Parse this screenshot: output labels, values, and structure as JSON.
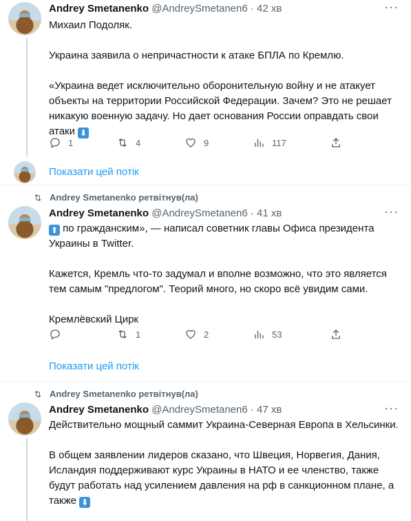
{
  "tweets": [
    {
      "retweeted_by": "",
      "name": "Andrey Smetanenko",
      "handle": "@AndreySmetanen6",
      "time": "42 хв",
      "paragraphs": [
        "Михаил Подоляк.",
        "Украина заявила о непричастности к атаке БПЛА по Кремлю.",
        "«Украина ведет исключительно оборонительную войну и не атакует объекты на территории Российской Федерации. Зачем? Это не решает никакую военную задачу. Но дает основания России оправдать свои атаки"
      ],
      "stats": {
        "replies": "1",
        "retweets": "4",
        "likes": "9",
        "views": "117"
      },
      "show_thread": "Показати цей потік"
    },
    {
      "retweeted_by": "Andrey Smetanenko ретвітнув(ла)",
      "name": "Andrey Smetanenko",
      "handle": "@AndreySmetanen6",
      "time": "41 хв",
      "paragraphs": [
        " по гражданским», — написал советник главы Офиса президента Украины в Twitter.",
        "Кажется, Кремль что-то задумал и вполне возможно, что это является тем самым \"предлогом\". Теорий много, но скоро всё увидим сами.",
        "Кремлёвский Цирк"
      ],
      "stats": {
        "replies": "",
        "retweets": "1",
        "likes": "2",
        "views": "53"
      },
      "show_thread": "Показати цей потік"
    },
    {
      "retweeted_by": "Andrey Smetanenko ретвітнув(ла)",
      "name": "Andrey Smetanenko",
      "handle": "@AndreySmetanen6",
      "time": "47 хв",
      "paragraphs": [
        "Действительно мощный саммит Украина-Северная Европа в Хельсинки.",
        "В общем заявлении лидеров сказано, что Швеция, Норвегия, Дания, Исландия поддерживают курс Украины в НАТО и ее членство, также будут работать над усилением давления на рф в санкционном плане, а также"
      ]
    }
  ],
  "ui": {
    "dot": "·",
    "more_glyph": "···",
    "emoji_down": "⬇",
    "emoji_up": "⬆"
  },
  "colors": {
    "accent": "#1d9bf0",
    "muted": "#536471",
    "text": "#0f1419",
    "border": "#eff3f4"
  }
}
